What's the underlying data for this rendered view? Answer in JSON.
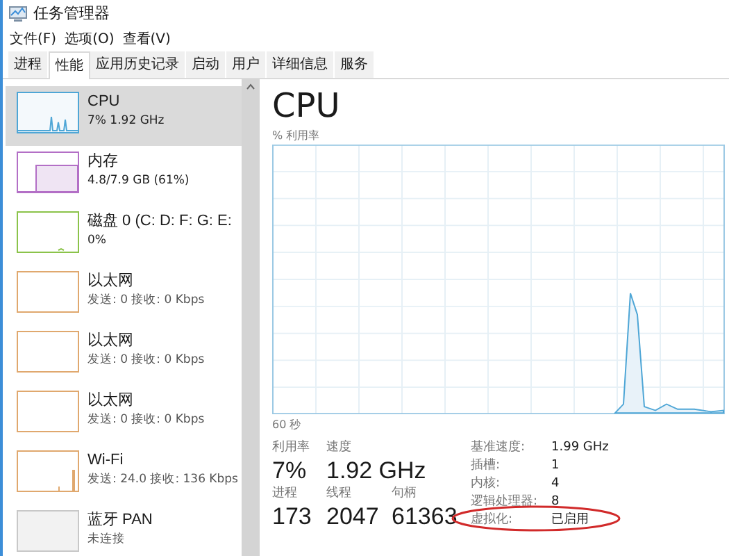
{
  "window": {
    "title": "任务管理器"
  },
  "menu": [
    "文件(F)",
    "选项(O)",
    "查看(V)"
  ],
  "tabs": [
    {
      "label": "进程",
      "selected": false
    },
    {
      "label": "性能",
      "selected": true
    },
    {
      "label": "应用历史记录",
      "selected": false
    },
    {
      "label": "启动",
      "selected": false
    },
    {
      "label": "用户",
      "selected": false
    },
    {
      "label": "详细信息",
      "selected": false
    },
    {
      "label": "服务",
      "selected": false
    }
  ],
  "sidebar": {
    "items": [
      {
        "name": "CPU",
        "detail": "7% 1.92 GHz",
        "kind": "cpu",
        "color": "#4ea6d6",
        "selected": true
      },
      {
        "name": "内存",
        "detail": "4.8/7.9 GB (61%)",
        "kind": "memory",
        "color": "#b36fc6",
        "selected": false
      },
      {
        "name": "磁盘 0 (C: D: F: G: E:",
        "detail": "0%",
        "kind": "disk",
        "color": "#8bc34a",
        "selected": false
      },
      {
        "name": "以太网",
        "detail": "发送: 0 接收: 0 Kbps",
        "kind": "net",
        "color": "#e0a86e",
        "selected": false
      },
      {
        "name": "以太网",
        "detail": "发送: 0 接收: 0 Kbps",
        "kind": "net",
        "color": "#e0a86e",
        "selected": false
      },
      {
        "name": "以太网",
        "detail": "发送: 0 接收: 0 Kbps",
        "kind": "net",
        "color": "#e0a86e",
        "selected": false
      },
      {
        "name": "Wi-Fi",
        "detail": "发送: 24.0 接收: 136 Kbps",
        "kind": "wifi",
        "color": "#e0a86e",
        "selected": false
      },
      {
        "name": "蓝牙 PAN",
        "detail": "未连接",
        "kind": "off",
        "color": "#c8c8c8",
        "selected": false
      }
    ]
  },
  "main": {
    "title": "CPU",
    "chart_label": "% 利用率",
    "time_label": "60 秒",
    "stats": [
      {
        "label": "利用率",
        "value": "7%"
      },
      {
        "label": "速度",
        "value": "1.92 GHz"
      },
      {
        "label": "进程",
        "value": "173"
      },
      {
        "label": "线程",
        "value": "2047"
      },
      {
        "label": "句柄",
        "value": "61363"
      }
    ],
    "details": [
      {
        "label": "基准速度:",
        "value": "1.99 GHz"
      },
      {
        "label": "插槽:",
        "value": "1"
      },
      {
        "label": "内核:",
        "value": "4"
      },
      {
        "label": "逻辑处理器:",
        "value": "8"
      },
      {
        "label": "虚拟化:",
        "value": "已启用"
      }
    ]
  }
}
